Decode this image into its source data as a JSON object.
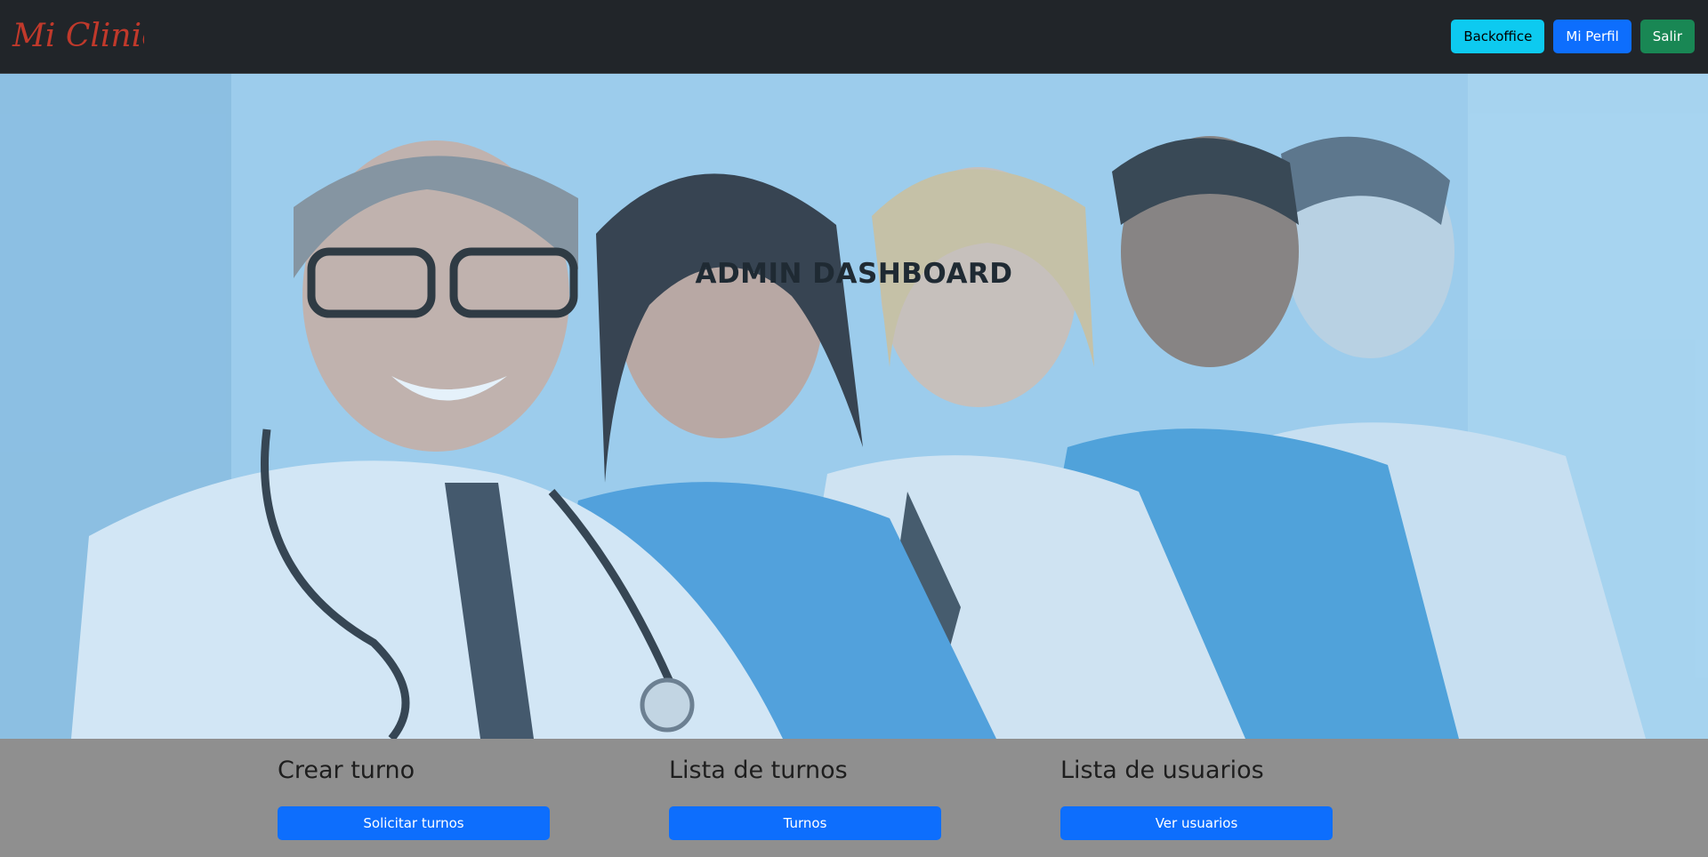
{
  "brand": {
    "logo_text": "Mi Clinica",
    "logo_color": "#c0392b"
  },
  "nav": {
    "backoffice_label": "Backoffice",
    "profile_label": "Mi Perfil",
    "logout_label": "Salir"
  },
  "hero": {
    "title": "ADMIN DASHBOARD"
  },
  "cards": [
    {
      "title": "Crear turno",
      "button_label": "Solicitar turnos"
    },
    {
      "title": "Lista de turnos",
      "button_label": "Turnos"
    },
    {
      "title": "Lista de usuarios",
      "button_label": "Ver usuarios"
    }
  ],
  "colors": {
    "navbar": "#212529",
    "info": "#0dcaf0",
    "primary": "#0d6efd",
    "success": "#198754",
    "footer_bg": "#8f8f8f"
  }
}
